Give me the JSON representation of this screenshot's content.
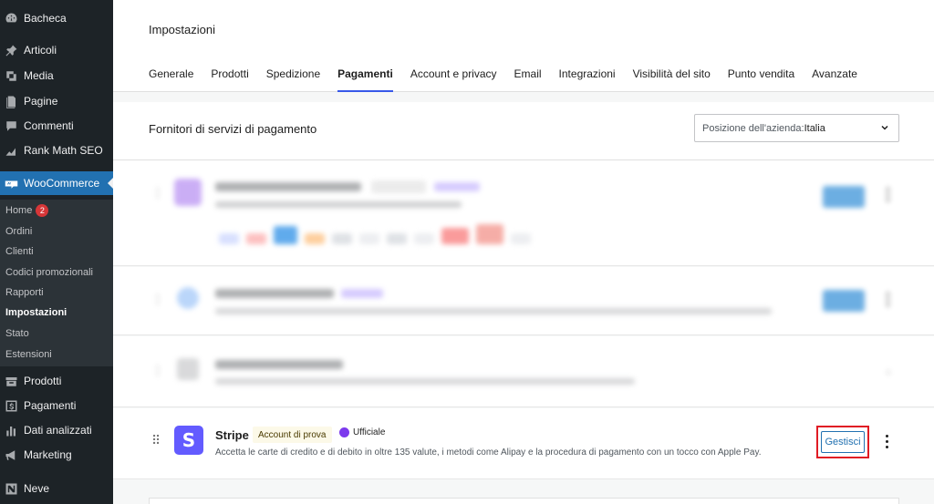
{
  "sidebar": {
    "items": [
      {
        "label": "Bacheca",
        "icon": "dashboard-icon"
      },
      {
        "label": "Articoli",
        "icon": "pin-icon"
      },
      {
        "label": "Media",
        "icon": "media-icon"
      },
      {
        "label": "Pagine",
        "icon": "page-icon"
      },
      {
        "label": "Commenti",
        "icon": "comment-icon"
      },
      {
        "label": "Rank Math SEO",
        "icon": "chart-icon"
      },
      {
        "label": "WooCommerce",
        "icon": "woo-icon"
      },
      {
        "label": "Prodotti",
        "icon": "box-icon"
      },
      {
        "label": "Pagamenti",
        "icon": "dollar-icon"
      },
      {
        "label": "Dati analizzati",
        "icon": "bar-chart-icon"
      },
      {
        "label": "Marketing",
        "icon": "megaphone-icon"
      },
      {
        "label": "Neve",
        "icon": "neve-icon"
      }
    ],
    "submenu": [
      {
        "label": "Home",
        "badge": "2"
      },
      {
        "label": "Ordini"
      },
      {
        "label": "Clienti"
      },
      {
        "label": "Codici promozionali"
      },
      {
        "label": "Rapporti"
      },
      {
        "label": "Impostazioni",
        "current": true
      },
      {
        "label": "Stato"
      },
      {
        "label": "Estensioni"
      }
    ]
  },
  "header": {
    "title": "Impostazioni",
    "tabs": [
      "Generale",
      "Prodotti",
      "Spedizione",
      "Pagamenti",
      "Account e privacy",
      "Email",
      "Integrazioni",
      "Visibilità del sito",
      "Punto vendita",
      "Avanzate"
    ],
    "active_tab": "Pagamenti"
  },
  "section": {
    "title": "Fornitori di servizi di pagamento",
    "country_label": "Posizione dell'azienda: ",
    "country_value": "Italia"
  },
  "stripe": {
    "logo_letter": "S",
    "name": "Stripe",
    "tag": "Account di prova",
    "official": "Ufficiale",
    "description": "Accetta le carte di credito e di debito in oltre 135 valute, i metodi come Alipay e la procedura di pagamento con un tocco con Apple Pay.",
    "manage_label": "Gestisci"
  },
  "colors": {
    "sidebar_bg": "#1d2327",
    "accent": "#2271b1",
    "stripe": "#635bff",
    "highlight": "#e01b24"
  }
}
